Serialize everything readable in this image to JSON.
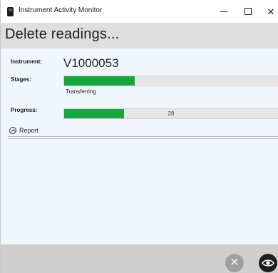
{
  "window": {
    "title": "Instrument Activity Monitor",
    "controls": {
      "minimize": "—",
      "maximize": "☐",
      "close": "✕"
    }
  },
  "header": {
    "title": "Delete readings..."
  },
  "details": {
    "instrument_label": "Instrument:",
    "instrument_value": "V1000053",
    "stages_label": "Stages:",
    "stage_progress_fraction": 0.33,
    "stage_status": "Transferring",
    "progress_label": "Progress:",
    "progress_fraction": 0.28,
    "progress_text": "28"
  },
  "report": {
    "label": "Report",
    "icon": "chevron-up-icon"
  },
  "footer": {
    "cancel_icon": "close-icon",
    "view_icon": "eye-icon"
  },
  "colors": {
    "progress_fill": "#14a83c",
    "body_bg": "#f1f6fc",
    "header_bg": "#dedede",
    "footer_bg": "#cfcfcf"
  }
}
